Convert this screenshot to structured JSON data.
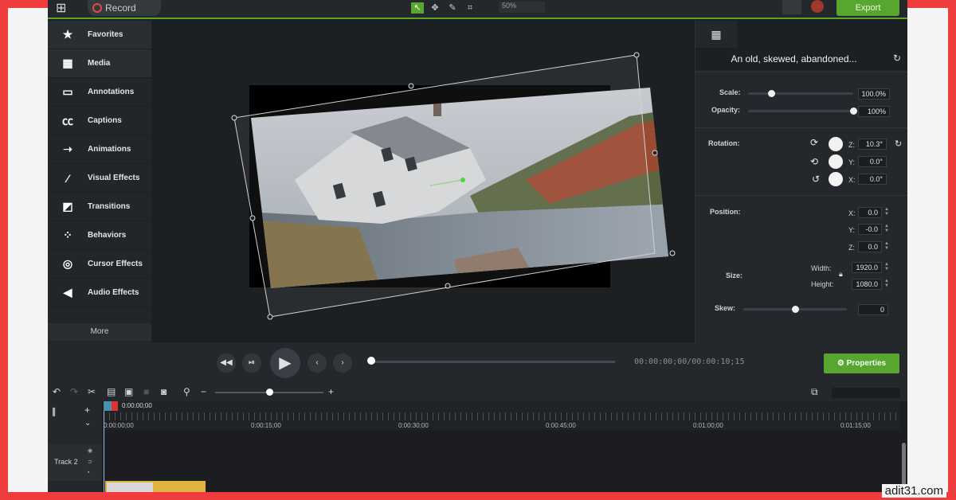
{
  "topbar": {
    "record_label": "Record",
    "zoom_value": "50%",
    "export_label": "Export",
    "tools": [
      "pointer-icon",
      "pan-icon",
      "pen-icon",
      "crop-icon"
    ]
  },
  "sidebar": {
    "items": [
      {
        "label": "Favorites",
        "icon": "★"
      },
      {
        "label": "Media",
        "icon": "▦"
      },
      {
        "label": "Annotations",
        "icon": "▭"
      },
      {
        "label": "Captions",
        "icon": "㏄"
      },
      {
        "label": "Animations",
        "icon": "➝"
      },
      {
        "label": "Visual Effects",
        "icon": "⁄"
      },
      {
        "label": "Transitions",
        "icon": "◩"
      },
      {
        "label": "Behaviors",
        "icon": "⁘"
      },
      {
        "label": "Cursor Effects",
        "icon": "◎"
      },
      {
        "label": "Audio Effects",
        "icon": "◀"
      }
    ],
    "more_label": "More"
  },
  "properties": {
    "clip_name": "An old, skewed, abandoned...",
    "scale_label": "Scale:",
    "scale_value": "100.0%",
    "scale_fraction": 0.22,
    "opacity_label": "Opacity:",
    "opacity_value": "100%",
    "opacity_fraction": 1.0,
    "rotation_label": "Rotation:",
    "rotation": [
      {
        "axis": "Z:",
        "value": "10.3°"
      },
      {
        "axis": "Y:",
        "value": "0.0°"
      },
      {
        "axis": "X:",
        "value": "0.0°"
      }
    ],
    "position_label": "Position:",
    "position": [
      {
        "axis": "X:",
        "value": "0.0"
      },
      {
        "axis": "Y:",
        "value": "-0.0"
      },
      {
        "axis": "Z:",
        "value": "0.0"
      }
    ],
    "size_label": "Size:",
    "width_label": "Width:",
    "width_value": "1920.0",
    "height_label": "Height:",
    "height_value": "1080.0",
    "skew_label": "Skew:",
    "skew_value": "0",
    "skew_fraction": 0.5
  },
  "playback": {
    "timecode": "00:00:00;00/00:00:10;15",
    "properties_label": "Properties"
  },
  "timeline": {
    "playhead_time": "0:00:00;00",
    "ruler_labels": [
      "0:00:00;00",
      "0:00:15;00",
      "0:00:30;00",
      "0:00:45;00",
      "0:01:00;00",
      "0:01:15;00"
    ],
    "track_name": "Track 2"
  },
  "watermark": "adit31.com",
  "colors": {
    "accent": "#58a630",
    "panel": "#24282c",
    "background": "#1d2023",
    "frame": "#f03c3c"
  }
}
